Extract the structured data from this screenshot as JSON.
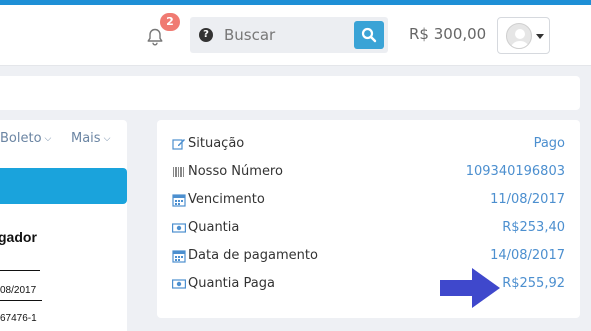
{
  "header": {
    "notifications_count": "2",
    "search_placeholder": "Buscar",
    "help_glyph": "?",
    "balance": "R$ 300,00",
    "icons": [
      "bell-icon",
      "help-icon",
      "search-icon",
      "avatar",
      "caret-down-icon"
    ]
  },
  "left_panel": {
    "menu": [
      {
        "label": "Boleto",
        "icon": "chevron-down-icon"
      },
      {
        "label": "Mais",
        "icon": "chevron-down-icon"
      }
    ],
    "document": {
      "title_fragment": "gador",
      "line1": "08/2017",
      "line2": "67476-1"
    }
  },
  "details": {
    "rows": [
      {
        "label": "Situação",
        "value": "Pago",
        "icon": "edit-icon"
      },
      {
        "label": "Nosso Número",
        "value": "109340196803",
        "icon": "barcode-icon"
      },
      {
        "label": "Vencimento",
        "value": "11/08/2017",
        "icon": "calendar-icon"
      },
      {
        "label": "Quantia",
        "value": "R$253,40",
        "icon": "money-icon"
      },
      {
        "label": "Data de pagamento",
        "value": "14/08/2017",
        "icon": "calendar-icon"
      },
      {
        "label": "Quantia Paga",
        "value": "R$255,92",
        "icon": "money-icon"
      }
    ]
  },
  "colors": {
    "accent": "#1e8fd6",
    "value_text": "#4c8fcf",
    "badge": "#f07a72",
    "search_button": "#3aa3d6",
    "arrow": "#3f48cc"
  }
}
